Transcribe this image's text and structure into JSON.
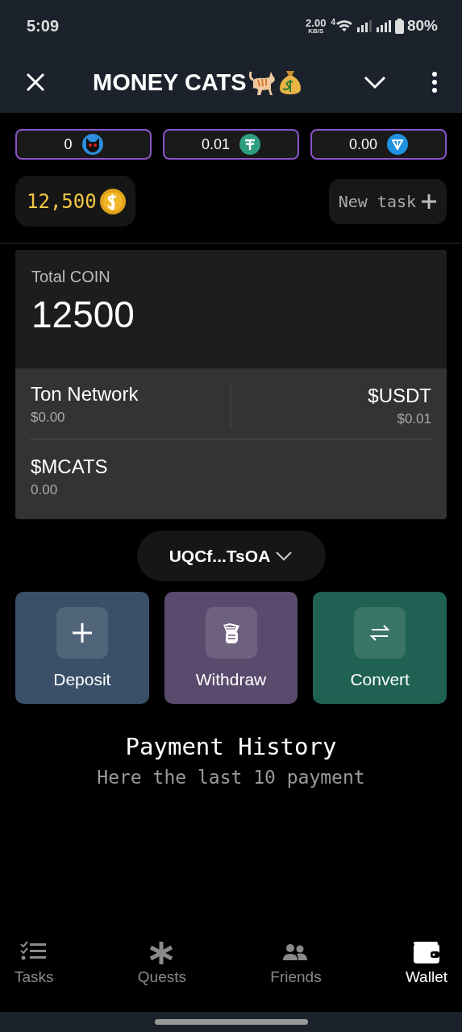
{
  "status_bar": {
    "time": "5:09",
    "speed": "2.00",
    "speed_unit": "KB/S",
    "network": "4",
    "battery": "80%"
  },
  "header": {
    "title": "MONEY CATS"
  },
  "balances": [
    {
      "value": "0",
      "kind": "cat"
    },
    {
      "value": "0.01",
      "kind": "tether"
    },
    {
      "value": "0.00",
      "kind": "ton"
    }
  ],
  "coins": {
    "amount": "12,500"
  },
  "new_task": {
    "label": "New task"
  },
  "total": {
    "label": "Total COIN",
    "value": "12500"
  },
  "assets": [
    {
      "name": "Ton Network",
      "amount": "$0.00"
    },
    {
      "name": "$USDT",
      "amount": "$0.01"
    },
    {
      "name": "$MCATS",
      "amount": "0.00"
    }
  ],
  "address": {
    "label": "UQCf...TsOA"
  },
  "actions": [
    {
      "label": "Deposit",
      "kind": "plus",
      "color": "#3a5068"
    },
    {
      "label": "Withdraw",
      "kind": "cash",
      "color": "#5a4a6e"
    },
    {
      "label": "Convert",
      "kind": "swap",
      "color": "#1f6152"
    }
  ],
  "history": {
    "title": "Payment History",
    "subtitle": "Here the last 10 payment"
  },
  "tabs": [
    {
      "label": "Tasks",
      "kind": "tasks",
      "selected": false
    },
    {
      "label": "Quests",
      "kind": "quests",
      "selected": false
    },
    {
      "label": "Friends",
      "kind": "friends",
      "selected": false
    },
    {
      "label": "Wallet",
      "kind": "wallet",
      "selected": true
    }
  ]
}
